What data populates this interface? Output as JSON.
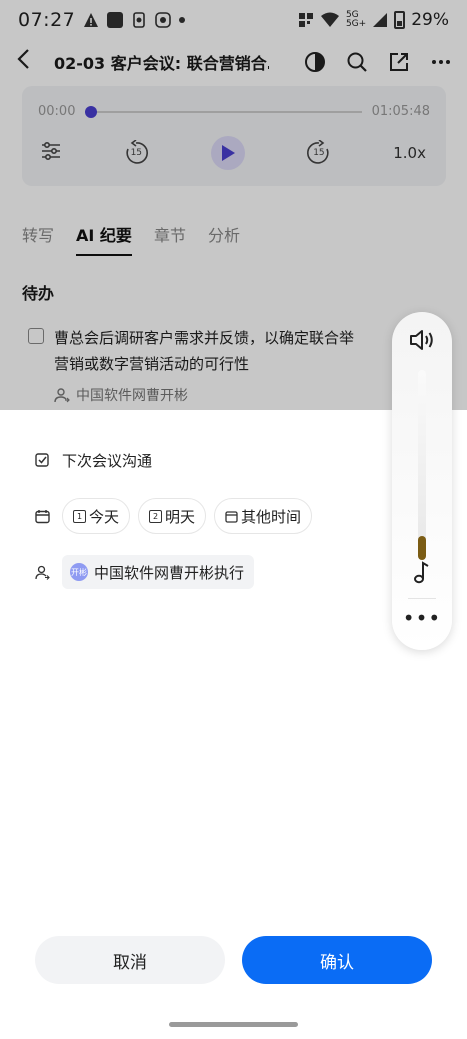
{
  "status_bar": {
    "time": "07:27",
    "network_top": "5G",
    "network_bottom": "5G+",
    "battery": "29%"
  },
  "app_bar": {
    "title": "02-03 客户会议: 联合营销合…"
  },
  "player": {
    "current_time": "00:00",
    "total_time": "01:05:48",
    "rewind_seconds": "15",
    "forward_seconds": "15",
    "speed": "1.0x",
    "progress": 0
  },
  "tabs": [
    {
      "label": "转写"
    },
    {
      "label": "AI 纪要"
    },
    {
      "label": "章节"
    },
    {
      "label": "分析"
    }
  ],
  "todo_section": {
    "title": "待办",
    "item_text": "曹总会后调研客户需求并反馈，以确定联合举",
    "item_text_line2": "营销或数字营销活动的可行性",
    "assignee": "中国软件网曹开彬"
  },
  "sheet": {
    "task": "下次会议沟通",
    "date_options": [
      {
        "icon_text": "1",
        "label": "今天"
      },
      {
        "icon_text": "2",
        "label": "明天"
      },
      {
        "icon_text": "",
        "label": "其他时间"
      }
    ],
    "avatar_text": "开彬",
    "assignee_label": "中国软件网曹开彬执行",
    "cancel_label": "取消",
    "confirm_label": "确认"
  },
  "volume_panel": {
    "level": 0.1
  },
  "colors": {
    "primary": "#0a6cf5",
    "player_accent": "#4a3fd0",
    "volume_fill": "#7b5c14"
  }
}
